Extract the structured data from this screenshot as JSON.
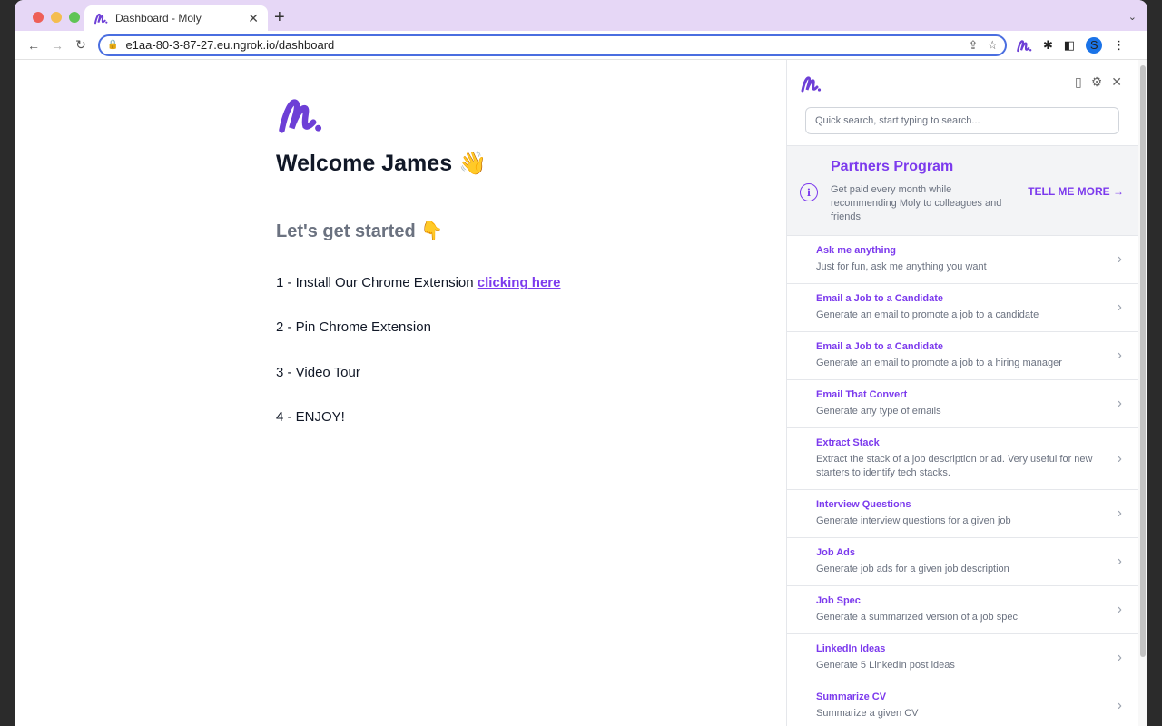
{
  "browser": {
    "tab_title": "Dashboard - Moly",
    "url": "e1aa-80-3-87-27.eu.ngrok.io/dashboard",
    "profile_initial": "S"
  },
  "page": {
    "welcome": "Welcome James 👋",
    "started": "Let's get started 👇",
    "steps": [
      {
        "text": "1 - Install Our Chrome Extension ",
        "link": "clicking here"
      },
      {
        "text": "2 - Pin Chrome Extension"
      },
      {
        "text": "3 - Video Tour"
      },
      {
        "text": "4 - ENJOY!"
      }
    ]
  },
  "panel": {
    "search_placeholder": "Quick search, start typing to search...",
    "partners": {
      "title": "Partners Program",
      "text": "Get paid every month while recommending Moly to colleagues and friends",
      "cta": "TELL ME MORE →"
    },
    "items": [
      {
        "title": "Ask me anything",
        "desc": "Just for fun, ask me anything you want"
      },
      {
        "title": "Email a Job to a Candidate",
        "desc": "Generate an email to promote a job to a candidate"
      },
      {
        "title": "Email a Job to a Candidate",
        "desc": "Generate an email to promote a job to a hiring manager"
      },
      {
        "title": "Email That Convert",
        "desc": "Generate any type of emails"
      },
      {
        "title": "Extract Stack",
        "desc": "Extract the stack of a job description or ad. Very useful for new starters to identify tech stacks."
      },
      {
        "title": "Interview Questions",
        "desc": "Generate interview questions for a given job"
      },
      {
        "title": "Job Ads",
        "desc": "Generate job ads for a given job description"
      },
      {
        "title": "Job Spec",
        "desc": "Generate a summarized version of a job spec"
      },
      {
        "title": "LinkedIn Ideas",
        "desc": "Generate 5 LinkedIn post ideas"
      },
      {
        "title": "Summarize CV",
        "desc": "Summarize a given CV"
      }
    ]
  },
  "colors": {
    "accent": "#7c3aed",
    "tab_strip": "#e6d7f6"
  }
}
